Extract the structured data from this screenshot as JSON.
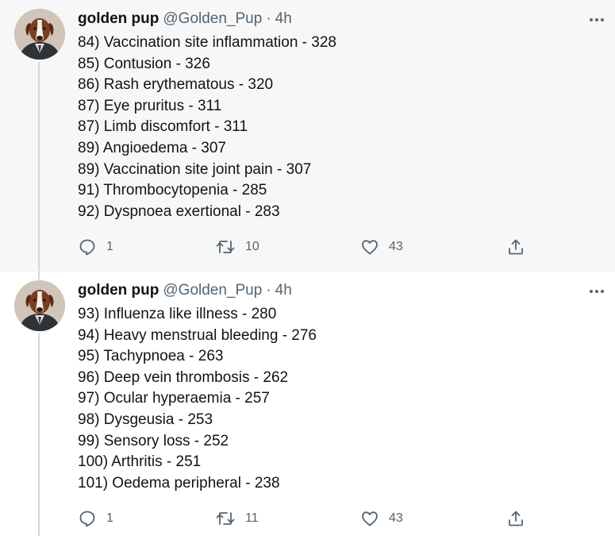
{
  "colors": {
    "muted": "#536471",
    "text": "#0f1419",
    "thread_line": "#cfd9de",
    "first_tweet_bg": "#f7f7f7"
  },
  "tweets": [
    {
      "display_name": "golden pup",
      "handle": "@Golden_Pup",
      "separator": "·",
      "time": "4h",
      "more_icon": "ellipsis-icon",
      "lines": [
        "84) Vaccination site inflammation - 328",
        "85) Contusion - 326",
        "86) Rash erythematous - 320",
        "87) Eye pruritus - 311",
        "87) Limb discomfort - 311",
        "89) Angioedema - 307",
        "89) Vaccination site joint pain - 307",
        "91) Thrombocytopenia - 285",
        "92) Dyspnoea exertional - 283"
      ],
      "replies": "1",
      "retweets": "10",
      "likes": "43"
    },
    {
      "display_name": "golden pup",
      "handle": "@Golden_Pup",
      "separator": "·",
      "time": "4h",
      "more_icon": "ellipsis-icon",
      "lines": [
        "93) Influenza like illness - 280",
        "94) Heavy menstrual bleeding - 276",
        "95) Tachypnoea - 263",
        "96) Deep vein thrombosis - 262",
        "97) Ocular hyperaemia - 257",
        "98) Dysgeusia - 253",
        "99) Sensory loss - 252",
        "100) Arthritis - 251",
        "101) Oedema peripheral - 238"
      ],
      "replies": "1",
      "retweets": "11",
      "likes": "43"
    }
  ]
}
